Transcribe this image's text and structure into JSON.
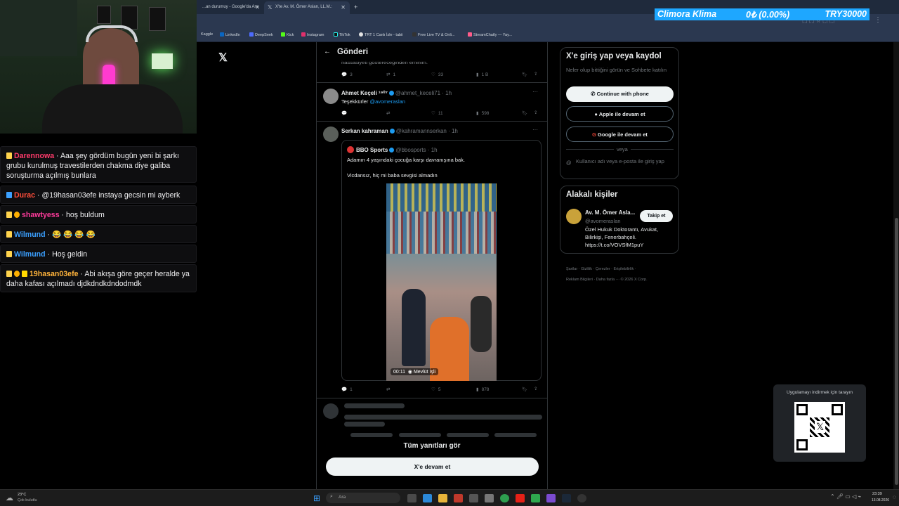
{
  "browser": {
    "tabs": [
      {
        "label": "...an durumuy - Google'da Ara",
        "active": false
      },
      {
        "label": "X'te Av. M. Ömer Aslan, LL.M.:",
        "active": true
      }
    ],
    "new_tab": "+",
    "bookmarks": [
      "Kaggle",
      "LinkedIn",
      "DeepSeek",
      "Kick",
      "Instagram",
      "TikTok",
      "TRT 1 Canlı İzle - tabii",
      "Free Live TV & Onli...",
      "StreamChatly — Yay..."
    ]
  },
  "ticker": {
    "name": "Climora Klima",
    "change": "0₺ (0.00%)",
    "price": "TRY30000"
  },
  "chat": [
    {
      "user": "Darennowa",
      "color": "#ff3b6b",
      "message": "Aaa şey gördüm bugün yeni bi şarkı grubu kurulmuş travestilerden chakma diye galiba soruşturma açılmış bunlara"
    },
    {
      "user": "Durac",
      "color": "#ff4e3b",
      "message": "@19hasan03efe instaya gecsin mi ayberk"
    },
    {
      "user": "shawtyess",
      "color": "#ff3b9b",
      "message": "hoş buldum"
    },
    {
      "user": "Wilmund",
      "color": "#3ba0ff",
      "message": "😂 😂 😂 😂"
    },
    {
      "user": "Wilmund",
      "color": "#3ba0ff",
      "message": "Hoş geldin"
    },
    {
      "user": "19hasan03efe",
      "color": "#ffb33b",
      "message": "Abi akışa göre geçer heralde ya daha kafası açılmadı djdkdndkdndodmdk"
    }
  ],
  "x": {
    "header": "Gönderi",
    "truncated_text": "hassasiyeti göstereceğinden eminim.",
    "tweet0_actions": {
      "replies": "3",
      "retweets": "1",
      "likes": "33",
      "views": "1 B"
    },
    "reply1": {
      "name": "Ahmet Keçeli ¹⁹⁰⁷",
      "handle": "@ahmet_keceli71 · 1h",
      "text": "Teşekkürler",
      "mention": "@avomeraslan",
      "actions": {
        "replies": "",
        "retweets": "",
        "likes": "11",
        "views": "598"
      }
    },
    "reply2": {
      "name": "Serkan kahraman",
      "handle": "@kahramannserkan · 1h",
      "quote": {
        "name": "BBO Sports",
        "handle": "@bbosports · 1h",
        "line1": "Adamın 4 yaşındaki çocuğa karşı davranışına bak.",
        "line2": "Vicdansız, hiç mi baba sevgisi almadın",
        "video_time": "00:11",
        "video_credit": "Mevlüt İşli"
      },
      "actions": {
        "replies": "1",
        "retweets": "",
        "likes": "5",
        "views": "878"
      }
    },
    "see_all": "Tüm yanıtları gör",
    "continue": "X'e devam et"
  },
  "sidebar": {
    "login_title": "X'e giriş yap veya kaydol",
    "login_sub": "Neler olup bittiğini görün ve Sohbete katılın",
    "phone": "Continue with phone",
    "apple": "Apple ile devam et",
    "google": "Google ile devam et",
    "or": "veya",
    "email": "Kullanıcı adı veya e-posta ile giriş yap",
    "related_title": "Alakalı kişiler",
    "person": {
      "name": "Av. M. Ömer Asla...",
      "handle": "@avomeraslan",
      "bio": "Özel Hukuk Doktorantı, Avukat, Bilirkişi, Fenerbahçeli. https://t.co/VOVSfM1puY",
      "follow": "Takip et"
    },
    "footer1": "Şartlar · Gizlilik · Çerezler · Erişilebilirlik ·",
    "footer2": "Reklam Bilgileri · Daha fazla ··· © 2026 X Corp.",
    "qr_title": "Uygulamayı indirmek için tarayın"
  },
  "taskbar": {
    "weather_temp": "23°C",
    "weather_desc": "Çok bulutlu",
    "search": "Ara",
    "time": "23:39",
    "date": "13.08.2026"
  }
}
